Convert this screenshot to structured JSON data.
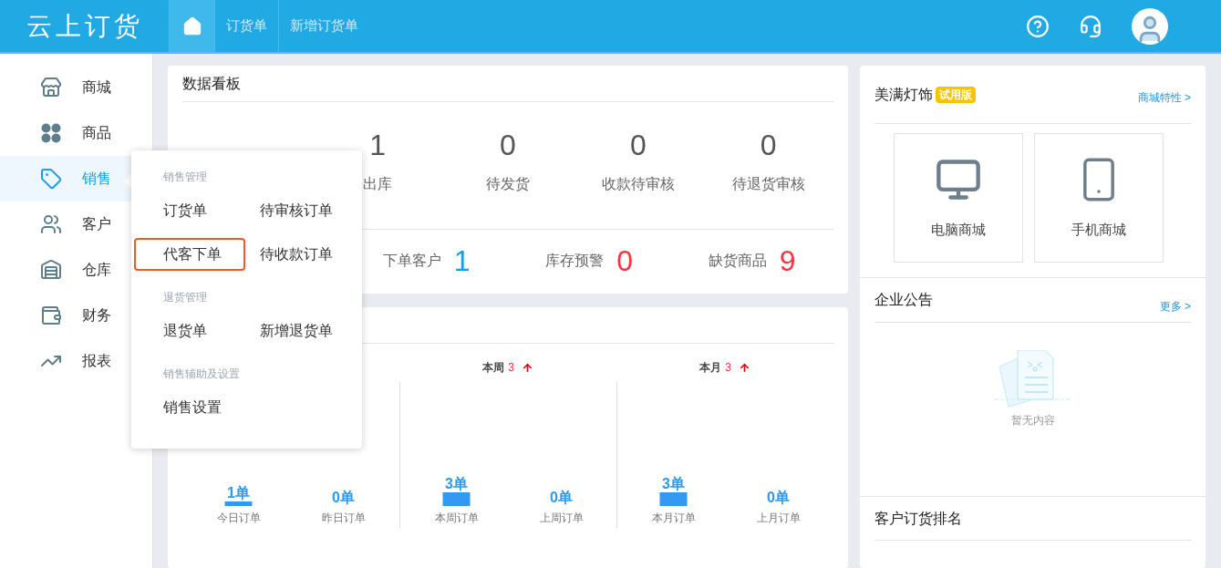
{
  "header": {
    "logo": "云上订货",
    "nav": [
      {
        "kind": "home",
        "selected": true
      },
      {
        "kind": "link",
        "label": "订货单",
        "selected": false
      },
      {
        "kind": "link",
        "label": "新增订货单",
        "selected": false
      }
    ]
  },
  "sidebar": {
    "items": [
      {
        "label": "商城",
        "selected": false
      },
      {
        "label": "商品",
        "selected": false
      },
      {
        "label": "销售",
        "selected": true
      },
      {
        "label": "客户",
        "selected": false
      },
      {
        "label": "仓库",
        "selected": false
      },
      {
        "label": "财务",
        "selected": false
      },
      {
        "label": "报表",
        "selected": false
      }
    ]
  },
  "menu": {
    "sections": [
      {
        "title": "销售管理",
        "items": [
          {
            "label": "订货单",
            "highlighted": false
          },
          {
            "label": "待审核订单",
            "highlighted": false
          },
          {
            "label": "代客下单",
            "highlighted": true
          },
          {
            "label": "待收款订单",
            "highlighted": false
          }
        ]
      },
      {
        "title": "退货管理",
        "items": [
          {
            "label": "退货单",
            "highlighted": false
          },
          {
            "label": "新增退货单",
            "highlighted": false
          }
        ]
      },
      {
        "title": "销售辅助及设置",
        "items": [
          {
            "label": "销售设置",
            "highlighted": false
          }
        ]
      }
    ]
  },
  "dashboard": {
    "title": "数据看板",
    "stats": [
      {
        "value": "1",
        "label": "出库"
      },
      {
        "value": "0",
        "label": "待发货"
      },
      {
        "value": "0",
        "label": "收款待审核"
      },
      {
        "value": "0",
        "label": "待退货审核"
      }
    ],
    "metrics": [
      {
        "label": "下单客户",
        "value": "1",
        "color": "#1a9ee6"
      },
      {
        "label": "库存预警",
        "value": "0",
        "color": "#f5363c"
      },
      {
        "label": "缺货商品",
        "value": "9",
        "color": "#f5363c"
      }
    ]
  },
  "orders": {
    "groups": [
      {
        "chart_data": {
          "type": "bar",
          "categories": [
            "今日订单",
            "昨日订单"
          ],
          "values": [
            1,
            0
          ],
          "value_labels": [
            "1单",
            "0单"
          ]
        }
      },
      {
        "title": "本周",
        "count": "3",
        "rising": true,
        "chart_data": {
          "type": "bar",
          "categories": [
            "本周订单",
            "上周订单"
          ],
          "values": [
            3,
            0
          ],
          "value_labels": [
            "3单",
            "0单"
          ]
        }
      },
      {
        "title": "本月",
        "count": "3",
        "rising": true,
        "chart_data": {
          "type": "bar",
          "categories": [
            "本月订单",
            "上月订单"
          ],
          "values": [
            3,
            0
          ],
          "value_labels": [
            "3单",
            "0单"
          ]
        }
      }
    ]
  },
  "store": {
    "name": "美满灯饰",
    "badge": "试用版",
    "link": "商城特性 >",
    "entries": [
      {
        "kind": "desktop",
        "label": "电脑商城"
      },
      {
        "kind": "mobile",
        "label": "手机商城"
      }
    ]
  },
  "notice": {
    "title": "企业公告",
    "link": "更多 >",
    "empty_text": "暂无内容"
  },
  "ranking": {
    "title": "客户订货排名"
  }
}
